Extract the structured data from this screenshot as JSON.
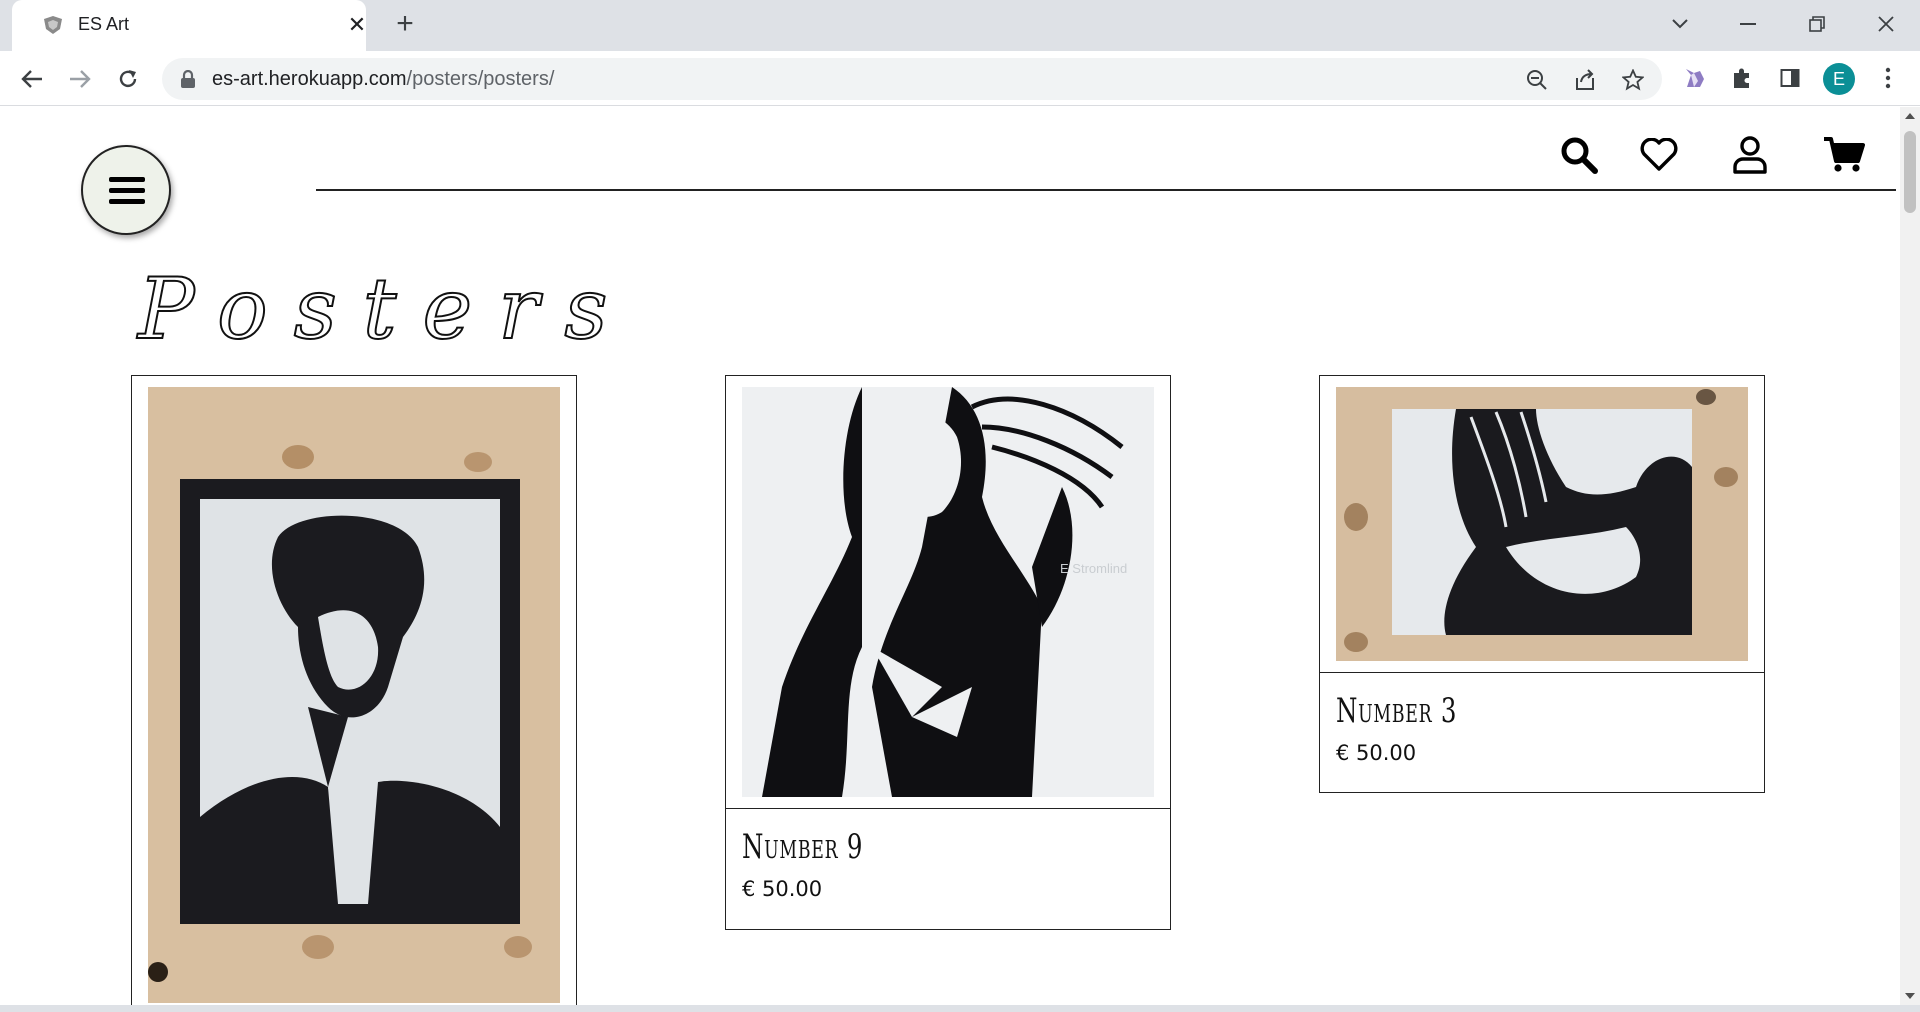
{
  "browser": {
    "tab_title": "ES Art",
    "url_domain": "es-art.herokuapp.com",
    "url_path": "/posters/posters/",
    "profile_initial": "E",
    "profile_color": "#0b8f96"
  },
  "page": {
    "title": "Posters"
  },
  "products": [
    {
      "name": "",
      "price": "",
      "image": "portrait-poster-man"
    },
    {
      "name": "Number 9",
      "price": "€ 50.00",
      "image": "portrait-poster-woman-dress",
      "watermark": "E Stromlind"
    },
    {
      "name": "Number 3",
      "price": "€ 50.00",
      "image": "poster-woman-back"
    }
  ]
}
